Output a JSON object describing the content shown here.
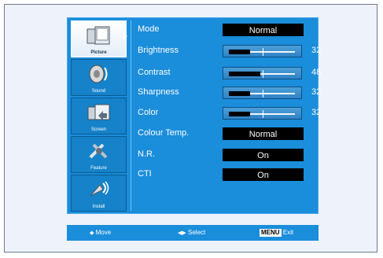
{
  "sidebar": {
    "items": [
      {
        "label": "Picture",
        "icon": "picture-icon",
        "active": true
      },
      {
        "label": "Sound",
        "icon": "sound-icon",
        "active": false
      },
      {
        "label": "Screen",
        "icon": "screen-icon",
        "active": false
      },
      {
        "label": "Feature",
        "icon": "feature-icon",
        "active": false
      },
      {
        "label": "Install",
        "icon": "install-icon",
        "active": false
      }
    ]
  },
  "menu": {
    "mode": {
      "label": "Mode",
      "value": "Normal"
    },
    "brightness": {
      "label": "Brightness",
      "value": "32",
      "level": 0.32
    },
    "contrast": {
      "label": "Contrast",
      "value": "48",
      "level": 0.48
    },
    "sharpness": {
      "label": "Sharpness",
      "value": "32",
      "level": 0.32
    },
    "color": {
      "label": "Color",
      "value": "32",
      "level": 0.32
    },
    "colour_temp": {
      "label": "Colour Temp.",
      "value": "Normal"
    },
    "nr": {
      "label": "N.R.",
      "value": "On"
    },
    "cti": {
      "label": "CTI",
      "value": "On"
    }
  },
  "footer": {
    "move": "Move",
    "select": "Select",
    "menu_key": "MENU",
    "exit": "Exit"
  },
  "colors": {
    "panel": "#1a8ddb",
    "frame": "#eef2fb",
    "value_box": "#000000"
  }
}
